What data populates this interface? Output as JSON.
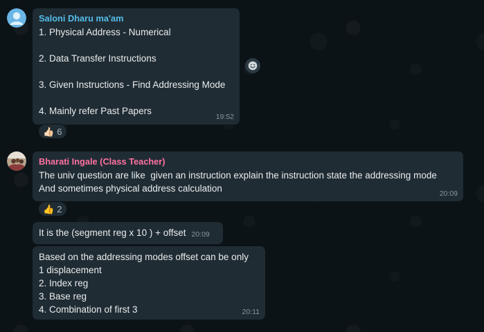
{
  "messages": [
    {
      "sender": "Saloni Dharu ma'am",
      "sender_color": "#53bdeb",
      "lines": [
        "1. Physical Address - Numerical",
        "",
        "2. Data Transfer Instructions",
        "",
        "3. Given Instructions - Find Addressing Mode",
        "",
        "4. Mainly refer Past Papers"
      ],
      "time": "19:52",
      "reaction": {
        "emoji": "👍🏻",
        "count": "6"
      }
    },
    {
      "sender": "Bharati Ingale (Class Teacher)",
      "sender_color": "#ff72a1",
      "lines": [
        "The univ question are like  given an instruction explain the instruction state the addressing mode",
        "And sometimes physical address calculation"
      ],
      "time": "20:09",
      "reaction": {
        "emoji": "👍",
        "count": "2"
      }
    },
    {
      "lines": [
        "It is the (segment reg x 10 ) + offset"
      ],
      "time": "20:09"
    },
    {
      "lines": [
        "Based on the addressing modes offset can be only",
        "1 displacement",
        "2. Index reg",
        "3. Base reg",
        "4. Combination of first 3"
      ],
      "time": "20:11"
    }
  ],
  "icons": {
    "avatar_1": "default-avatar-icon",
    "avatar_2": "profile-photo-avatar",
    "emoji_button": "smiley-icon"
  }
}
